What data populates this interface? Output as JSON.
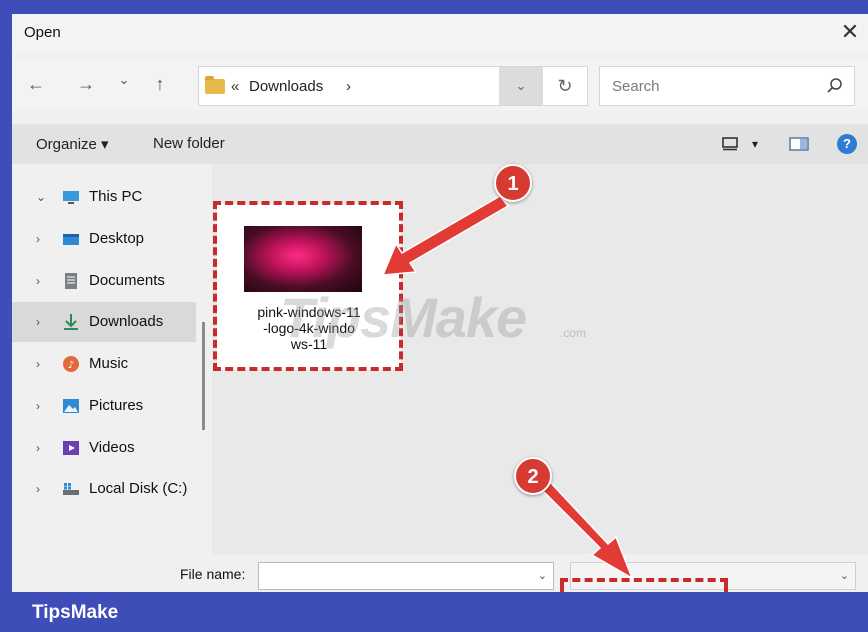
{
  "window": {
    "title": "Open",
    "close_glyph": "✕"
  },
  "nav": {
    "back_glyph": "←",
    "forward_glyph": "→",
    "recent_glyph": "⌄",
    "up_glyph": "↑",
    "address": {
      "separator": "«",
      "current": "Downloads",
      "chevron": "›"
    },
    "dropdown_glyph": "⌄",
    "refresh_glyph": "↻",
    "search_placeholder": "Search"
  },
  "toolbar": {
    "organize_label": "Organize ▾",
    "new_folder_label": "New folder",
    "view_dd_glyph": "▾",
    "help_glyph": "?"
  },
  "sidebar": {
    "items": [
      {
        "label": "This PC",
        "chevron": "⌄",
        "icon": "pc-icon"
      },
      {
        "label": "Desktop",
        "chevron": "›",
        "icon": "desktop-icon"
      },
      {
        "label": "Documents",
        "chevron": "›",
        "icon": "documents-icon"
      },
      {
        "label": "Downloads",
        "chevron": "›",
        "icon": "downloads-icon"
      },
      {
        "label": "Music",
        "chevron": "›",
        "icon": "music-icon"
      },
      {
        "label": "Pictures",
        "chevron": "›",
        "icon": "pictures-icon"
      },
      {
        "label": "Videos",
        "chevron": "›",
        "icon": "videos-icon"
      },
      {
        "label": "Local Disk (C:)",
        "chevron": "›",
        "icon": "disk-icon"
      }
    ]
  },
  "files": [
    {
      "name": "pink-windows-11-logo-4k-windows-11",
      "name_lines": [
        "pink-windows-11",
        "-logo-4k-windo",
        "ws-11"
      ]
    }
  ],
  "bottom": {
    "file_name_label": "File name:",
    "file_name_value": "",
    "chevron": "⌄"
  },
  "annotations": {
    "step1": "1",
    "step2": "2"
  },
  "watermark": {
    "text": "TipsMake",
    "suffix": ".com"
  },
  "banner": {
    "brand": "TipsMake"
  },
  "colors": {
    "accent": "#3f4db8",
    "annotation_red": "#d63a33",
    "folder": "#e7b84c"
  }
}
